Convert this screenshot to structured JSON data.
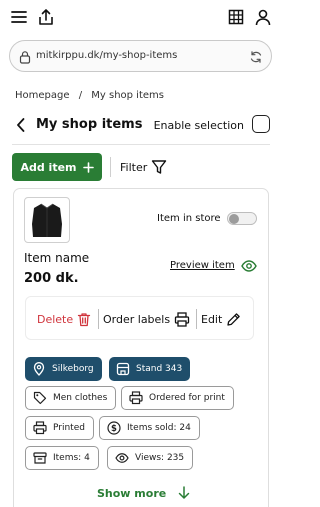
{
  "browser": {
    "url": "mitkirppu.dk/my-shop-items"
  },
  "breadcrumb": {
    "home": "Homepage",
    "separator": "/",
    "current": "My shop items"
  },
  "header": {
    "title": "My shop items",
    "enable_selection_label": "Enable selection"
  },
  "toolbar": {
    "add_item_label": "Add item",
    "filter_label": "Filter"
  },
  "item": {
    "name": "Item name",
    "price": "200 dk.",
    "in_store_label": "Item in store",
    "in_store_on": false,
    "preview_label": "Preview item",
    "actions": {
      "delete": "Delete",
      "order_labels": "Order labels",
      "edit": "Edit"
    },
    "tags": {
      "location": "Silkeborg",
      "stand": "Stand 343",
      "category": "Men clothes",
      "ordered": "Ordered for print",
      "printed": "Printed",
      "items_sold": "Items sold: 24",
      "items": "Items: 4",
      "views": "Views: 235"
    },
    "show_more_label": "Show more"
  },
  "colors": {
    "primary_green": "#2a7d35",
    "chip_dark": "#1f4e6b",
    "delete_red": "#d0343c"
  }
}
